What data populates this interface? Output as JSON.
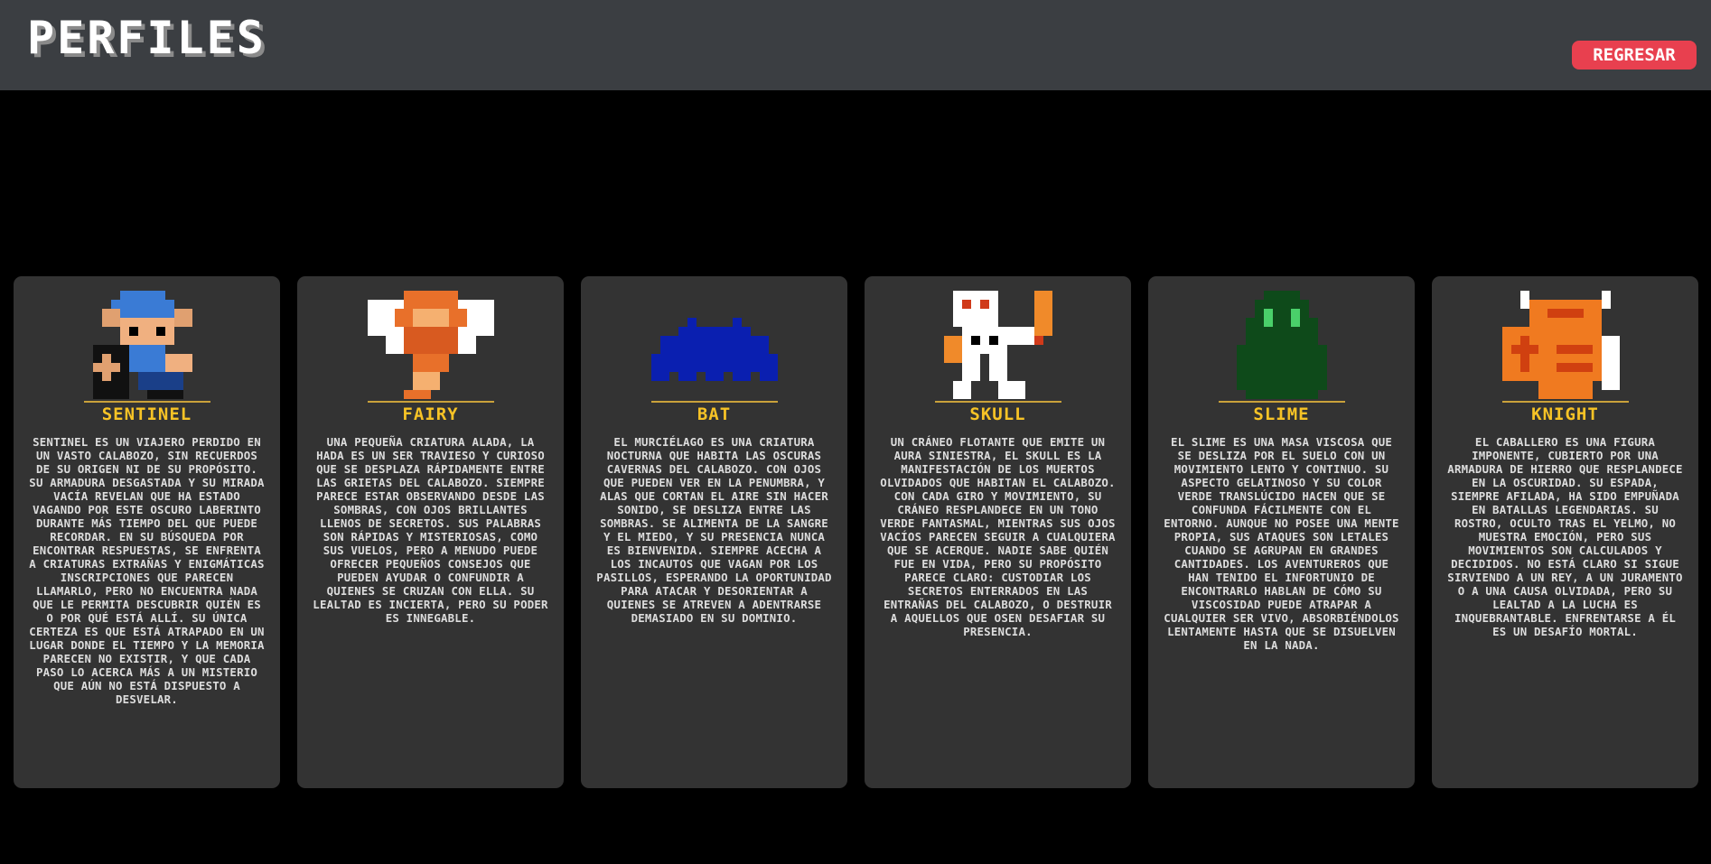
{
  "header": {
    "title": "PERFILES",
    "back_label": "REGRESAR"
  },
  "colors": {
    "header_bg": "#3b3e42",
    "card_bg": "#333333",
    "accent": "#f7c326",
    "button": "#e8404f"
  },
  "profiles": [
    {
      "name": "SENTINEL",
      "icon": "sentinel-sprite-icon",
      "description": "SENTINEL ES UN VIAJERO PERDIDO EN UN VASTO CALABOZO, SIN RECUERDOS DE SU ORIGEN NI DE SU PROPóSITO. SU ARMADURA DESGASTADA Y SU MIRADA VACíA REVELAN QUE HA ESTADO VAGANDO POR ESTE OSCURO LABERINTO DURANTE MáS TIEMPO DEL QUE PUEDE RECORDAR. EN SU BúSQUEDA POR ENCONTRAR RESPUESTAS, SE ENFRENTA A CRIATURAS EXTRAñAS Y ENIGMáTICAS INSCRIPCIONES QUE PARECEN LLAMARLO, PERO NO ENCUENTRA NADA QUE LE PERMITA DESCUBRIR QUIéN ES O POR QUé ESTá ALLí. SU úNICA CERTEZA ES QUE ESTá ATRAPADO EN UN LUGAR DONDE EL TIEMPO Y LA MEMORIA PARECEN NO EXISTIR, Y QUE CADA PASO LO ACERCA MáS A UN MISTERIO QUE AúN NO ESTá DISPUESTO A DESVELAR."
    },
    {
      "name": "FAIRY",
      "icon": "fairy-sprite-icon",
      "description": "UNA PEQUEñA CRIATURA ALADA, LA HADA ES UN SER TRAVIESO Y CURIOSO QUE SE DESPLAZA RáPIDAMENTE ENTRE LAS GRIETAS DEL CALABOZO. SIEMPRE PARECE ESTAR OBSERVANDO DESDE LAS SOMBRAS, CON OJOS BRILLANTES LLENOS DE SECRETOS. SUS PALABRAS SON RáPIDAS Y MISTERIOSAS, COMO SUS VUELOS, PERO A MENUDO PUEDE OFRECER PEQUEñOS CONSEJOS QUE PUEDEN AYUDAR O CONFUNDIR A QUIENES SE CRUZAN CON ELLA. SU LEALTAD ES INCIERTA, PERO SU PODER ES INNEGABLE."
    },
    {
      "name": "BAT",
      "icon": "bat-sprite-icon",
      "description": "EL MURCIéLAGO ES UNA CRIATURA NOCTURNA QUE HABITA LAS OSCURAS CAVERNAS DEL CALABOZO. CON OJOS QUE PUEDEN VER EN LA PENUMBRA, Y ALAS QUE CORTAN EL AIRE SIN HACER SONIDO, SE DESLIZA ENTRE LAS SOMBRAS. SE ALIMENTA DE LA SANGRE Y EL MIEDO, Y SU PRESENCIA NUNCA ES BIENVENIDA. SIEMPRE ACECHA A LOS INCAUTOS QUE VAGAN POR LOS PASILLOS, ESPERANDO LA OPORTUNIDAD PARA ATACAR Y DESORIENTAR A QUIENES SE ATREVEN A ADENTRARSE DEMASIADO EN SU DOMINIO."
    },
    {
      "name": "SKULL",
      "icon": "skull-sprite-icon",
      "description": "UN CRáNEO FLOTANTE QUE EMITE UN AURA SINIESTRA, EL SKULL ES LA MANIFESTACIóN DE LOS MUERTOS OLVIDADOS QUE HABITAN EL CALABOZO. CON CADA GIRO Y MOVIMIENTO, SU CRáNEO RESPLANDECE EN UN TONO VERDE FANTASMAL, MIENTRAS SUS OJOS VACíOS PARECEN SEGUIR A CUALQUIERA QUE SE ACERQUE. NADIE SABE QUIéN FUE EN VIDA, PERO SU PROPóSITO PARECE CLARO: CUSTODIAR LOS SECRETOS ENTERRADOS EN LAS ENTRAñAS DEL CALABOZO, O DESTRUIR A AQUELLOS QUE OSEN DESAFIAR SU PRESENCIA."
    },
    {
      "name": "SLIME",
      "icon": "slime-sprite-icon",
      "description": "EL SLIME ES UNA MASA VISCOSA QUE SE DESLIZA POR EL SUELO CON UN MOVIMIENTO LENTO Y CONTINUO. SU ASPECTO GELATINOSO Y SU COLOR VERDE TRANSLúCIDO HACEN QUE SE CONFUNDA FáCILMENTE CON EL ENTORNO. AUNQUE NO POSEE UNA MENTE PROPIA, SUS ATAQUES SON LETALES CUANDO SE AGRUPAN EN GRANDES CANTIDADES. LOS AVENTUREROS QUE HAN TENIDO EL INFORTUNIO DE ENCONTRARLO HABLAN DE CóMO SU VISCOSIDAD PUEDE ATRAPAR A CUALQUIER SER VIVO, ABSORBIéNDOLOS LENTAMENTE HASTA QUE SE DISUELVEN EN LA NADA."
    },
    {
      "name": "KNIGHT",
      "icon": "knight-sprite-icon",
      "description": "EL CABALLERO ES UNA FIGURA IMPONENTE, CUBIERTO POR UNA ARMADURA DE HIERRO QUE RESPLANDECE EN LA OSCURIDAD. SU ESPADA, SIEMPRE AFILADA, HA SIDO EMPUñADA EN BATALLAS LEGENDARIAS. SU ROSTRO, OCULTO TRAS EL YELMO, NO MUESTRA EMOCIóN, PERO SUS MOVIMIENTOS SON CALCULADOS Y DECIDIDOS. NO ESTá CLARO SI SIGUE SIRVIENDO A UN REY, A UN JURAMENTO O A UNA CAUSA OLVIDADA, PERO SU LEALTAD A LA LUCHA ES INQUEBRANTABLE. ENFRENTARSE A éL ES UN DESAFíO MORTAL."
    }
  ]
}
